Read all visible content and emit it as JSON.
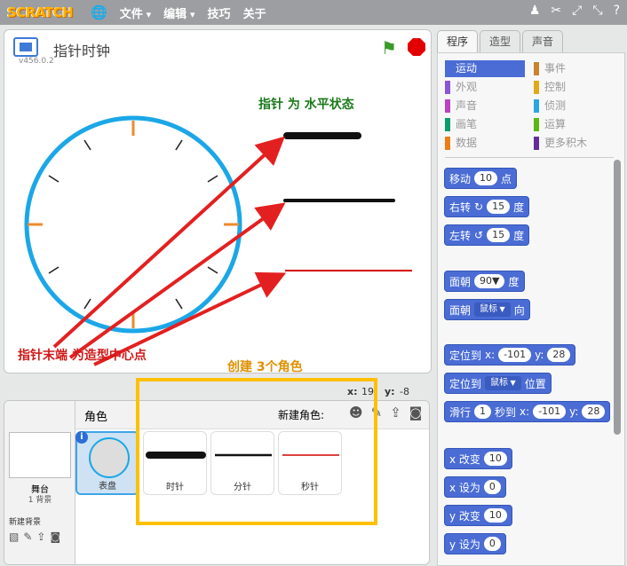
{
  "menubar": {
    "logo": "SCRATCH",
    "items": [
      "文件",
      "编辑",
      "技巧",
      "关于"
    ]
  },
  "stage": {
    "project_title": "指针时钟",
    "version": "v456.0.2",
    "x_label": "x:",
    "x_value": "19",
    "y_label": "y:",
    "y_value": "-8"
  },
  "annotations": {
    "top": "指针 为 水平状态",
    "left": "指针末端 为造型中心点",
    "bottom": "创建 3个角色"
  },
  "sprites_pane": {
    "title": "角色",
    "new_sprite_label": "新建角色:",
    "stage_label": "舞台",
    "backdrop_count": "1 背景",
    "new_backdrop_label": "新建背景",
    "sprites": [
      {
        "name": "表盘"
      },
      {
        "name": "时针"
      },
      {
        "name": "分针"
      },
      {
        "name": "秒针"
      }
    ]
  },
  "tabs": [
    "程序",
    "造型",
    "声音"
  ],
  "categories": [
    {
      "name": "运动",
      "color": "#4a6cd4"
    },
    {
      "name": "事件",
      "color": "#c88330"
    },
    {
      "name": "外观",
      "color": "#8a55d7"
    },
    {
      "name": "控制",
      "color": "#e1a91a"
    },
    {
      "name": "声音",
      "color": "#bb42c3"
    },
    {
      "name": "侦测",
      "color": "#2ca5e2"
    },
    {
      "name": "画笔",
      "color": "#0e9a6c"
    },
    {
      "name": "运算",
      "color": "#5cb712"
    },
    {
      "name": "数据",
      "color": "#ee7d16"
    },
    {
      "name": "更多积木",
      "color": "#632d99"
    }
  ],
  "blocks": {
    "move": {
      "a": "移动",
      "v": "10",
      "b": "点"
    },
    "turn_right": {
      "a": "右转",
      "v": "15",
      "b": "度"
    },
    "turn_left": {
      "a": "左转",
      "v": "15",
      "b": "度"
    },
    "point_dir": {
      "a": "面朝",
      "v": "90▼",
      "b": "度"
    },
    "point_towards": {
      "a": "面朝",
      "v": "鼠标",
      "b": "向"
    },
    "goto_xy": {
      "a": "定位到",
      "xl": "x:",
      "xv": "-101",
      "yl": "y:",
      "yv": "28"
    },
    "goto_target": {
      "a": "定位到",
      "v": "鼠标",
      "b": "位置"
    },
    "glide": {
      "a": "滑行",
      "v": "1",
      "b": "秒到",
      "xl": "x:",
      "xv": "-101",
      "yl": "y:",
      "yv": "28"
    },
    "change_x": {
      "a": "x 改变",
      "v": "10"
    },
    "set_x": {
      "a": "x 设为",
      "v": "0"
    },
    "change_y": {
      "a": "y 改变",
      "v": "10"
    },
    "set_y": {
      "a": "y 设为",
      "v": "0"
    }
  },
  "colors": {
    "clock_ring": "#1ba7e7",
    "arrow": "#e32020",
    "highlight": "#ffc000",
    "motion": "#4a6cd4"
  }
}
